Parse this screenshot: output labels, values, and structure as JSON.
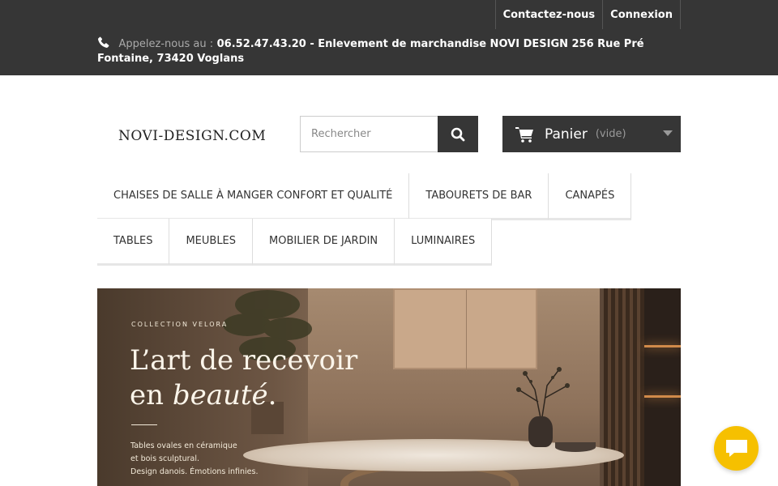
{
  "topbar": {
    "links": [
      {
        "label": "Contactez-nous"
      },
      {
        "label": "Connexion"
      }
    ],
    "contact_prefix": "Appelez-nous au :",
    "contact_text": "06.52.47.43.20 - Enlevement de marchandise NOVI DESIGN 256 Rue Pré Fontaine, 73420 Voglans",
    "phone_icon": "phone-icon"
  },
  "header": {
    "logo": "NOVI-DESIGN.COM",
    "search": {
      "placeholder": "Rechercher",
      "icon": "search-icon"
    },
    "cart": {
      "label": "Panier",
      "status": "(vide)",
      "icon": "cart-icon"
    }
  },
  "menu": {
    "row1": [
      {
        "label": "CHAISES DE SALLE À MANGER CONFORT ET QUALITÉ"
      },
      {
        "label": "TABOURETS DE BAR"
      },
      {
        "label": "CANAPÉS"
      }
    ],
    "row2": [
      {
        "label": "TABLES"
      },
      {
        "label": "MEUBLES"
      },
      {
        "label": "MOBILIER DE JARDIN"
      },
      {
        "label": "LUMINAIRES"
      }
    ]
  },
  "banner": {
    "eyebrow": "COLLECTION VELORA",
    "title_line1": "L’art de recevoir",
    "title_line2_prefix": "en ",
    "title_line2_italic": "beauté",
    "title_line2_suffix": ".",
    "desc_line1": "Tables ovales en céramique",
    "desc_line2": "et bois sculptural.",
    "desc_line3": "Design danois. Émotions infinies."
  },
  "chat": {
    "icon": "chat-icon"
  },
  "colors": {
    "topbar": "#363636",
    "chat": "#f6c000"
  }
}
